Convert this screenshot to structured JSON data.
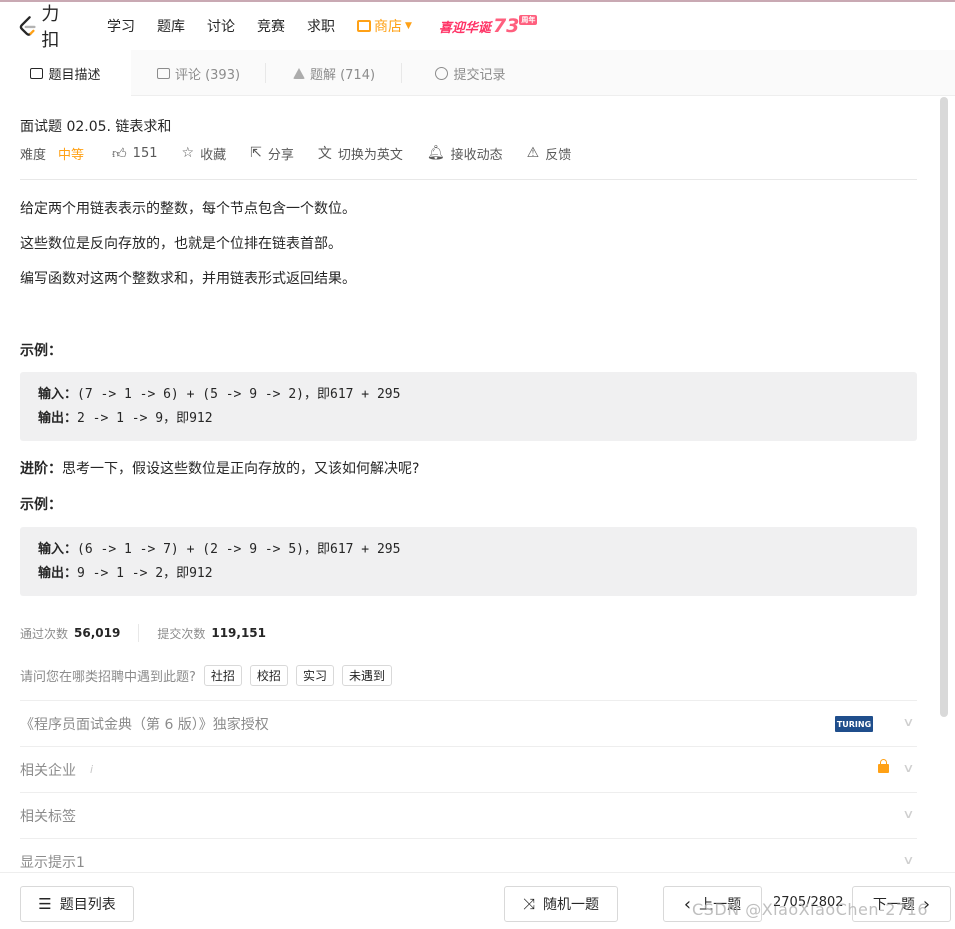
{
  "nav": {
    "logo_text": "力扣",
    "items": [
      "学习",
      "题库",
      "讨论",
      "竞赛",
      "求职"
    ],
    "store": "商店",
    "promo_text": "喜迎华诞",
    "promo_num": "73",
    "promo_badge": "周年"
  },
  "tabs": [
    {
      "label": "题目描述",
      "icon": "description-icon"
    },
    {
      "label": "评论 (393)",
      "icon": "comment-icon"
    },
    {
      "label": "题解 (714)",
      "icon": "flask-icon"
    },
    {
      "label": "提交记录",
      "icon": "clock-icon"
    }
  ],
  "problem": {
    "title": "面试题 02.05. 链表求和",
    "difficulty_label": "难度",
    "difficulty": "中等",
    "likes": "151",
    "favorite": "收藏",
    "share": "分享",
    "switch_lang": "切换为英文",
    "subscribe": "接收动态",
    "feedback": "反馈",
    "desc": [
      "给定两个用链表表示的整数，每个节点包含一个数位。",
      "这些数位是反向存放的，也就是个位排在链表首部。",
      "编写函数对这两个整数求和，并用链表形式返回结果。"
    ],
    "example_label": "示例：",
    "example1": {
      "in_label": "输入：",
      "in": "(7 -> 1 -> 6) + (5 -> 9 -> 2)，即617 + 295",
      "out_label": "输出：",
      "out": "2 -> 1 -> 9，即912"
    },
    "advanced_label": "进阶：",
    "advanced_text": "思考一下，假设这些数位是正向存放的，又该如何解决呢?",
    "example2_label": "示例：",
    "example2": {
      "in_label": "输入：",
      "in": "(6 -> 1 -> 7) + (2 -> 9 -> 5)，即617 + 295",
      "out_label": "输出：",
      "out": "9 -> 1 -> 2，即912"
    }
  },
  "stats": {
    "accepted_label": "通过次数",
    "accepted": "56,019",
    "submissions_label": "提交次数",
    "submissions": "119,151"
  },
  "survey": {
    "question": "请问您在哪类招聘中遇到此题?",
    "options": [
      "社招",
      "校招",
      "实习",
      "未遇到"
    ]
  },
  "accordions": {
    "copyright": "《程序员面试金典（第 6 版）》独家授权",
    "turing_logo": "TURING",
    "companies": "相关企业",
    "info": "i",
    "tags": "相关标签",
    "hint": "显示提示1"
  },
  "bottom": {
    "list": "题目列表",
    "random": "随机一题",
    "prev": "上一题",
    "pager": "2705/2802",
    "next": "下一题"
  },
  "watermark": "CSDN @XiaoXiaoChen-2716",
  "colors": {
    "accent": "#ffa116",
    "code_bg": "#f0f0f1"
  }
}
